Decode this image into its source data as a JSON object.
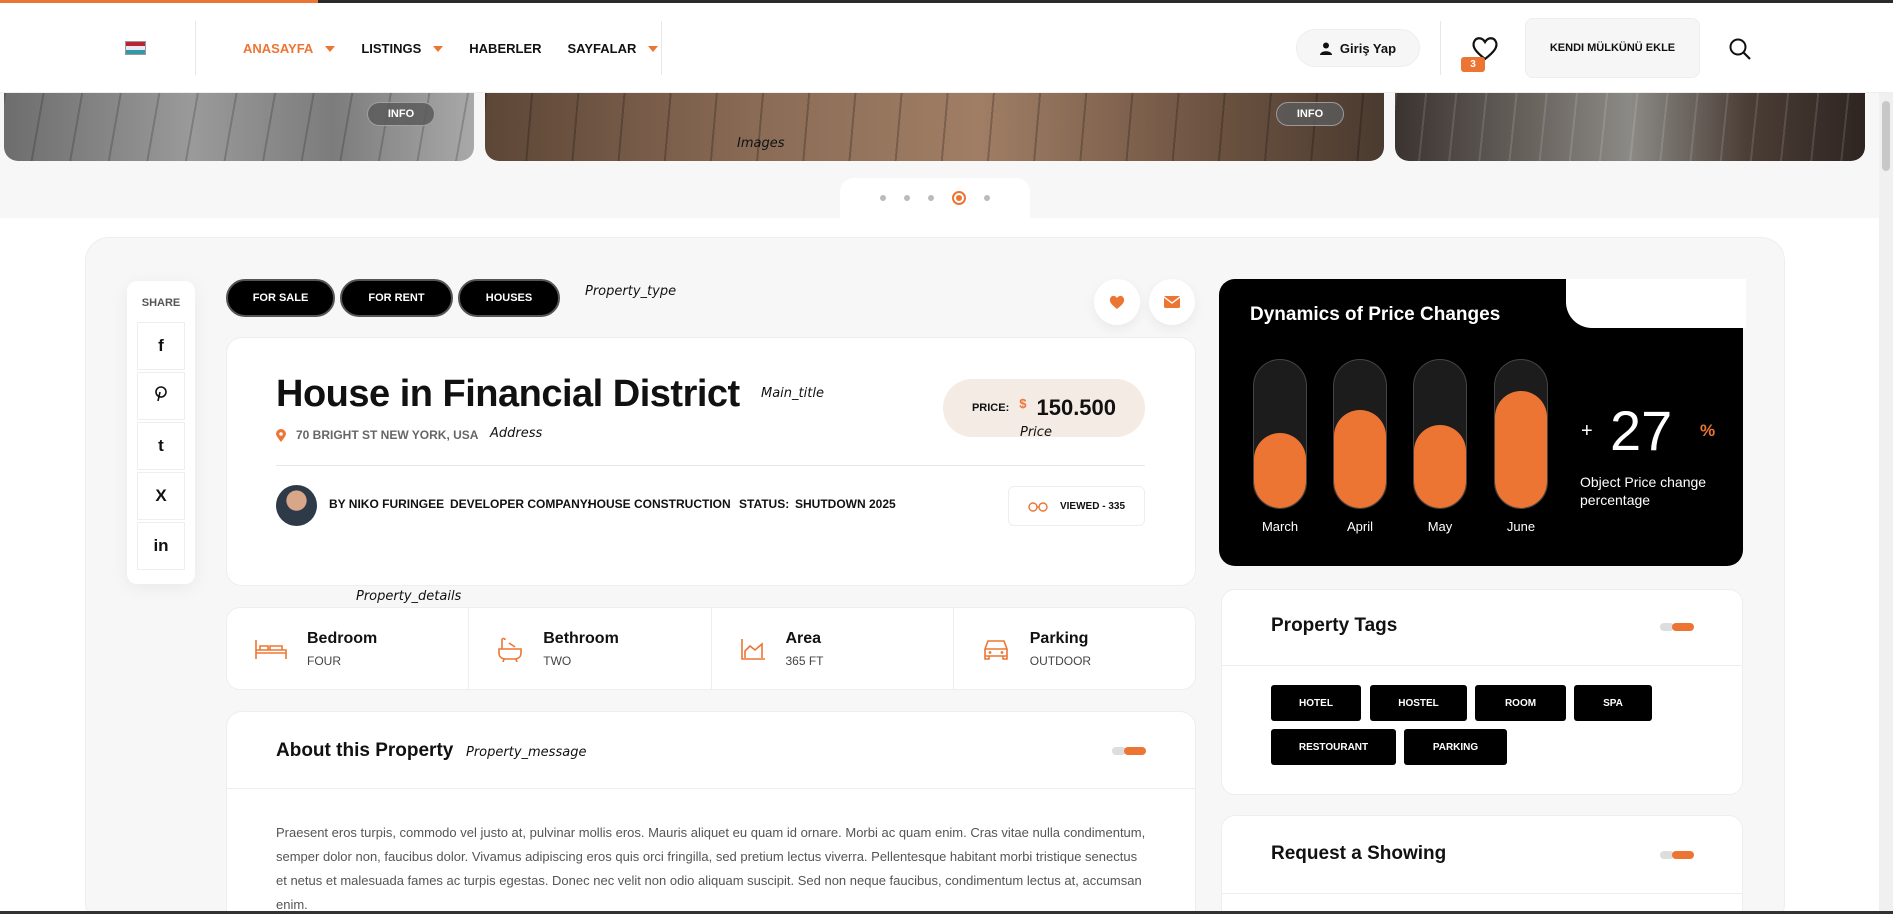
{
  "header": {
    "nav": [
      {
        "label": "ANASAYFA",
        "dropdown": true,
        "active": true
      },
      {
        "label": "LISTINGS",
        "dropdown": true,
        "active": false
      },
      {
        "label": "HABERLER",
        "dropdown": false,
        "active": false
      },
      {
        "label": "SAYFALAR",
        "dropdown": true,
        "active": false
      }
    ],
    "login_label": "Giriş Yap",
    "favorites_count": "3",
    "add_property_label": "KENDI MÜLKÜNÜ EKLE"
  },
  "gallery": {
    "info_label": "INFO",
    "annotation": "Images",
    "active_slide": 4,
    "slides": 5
  },
  "share": {
    "label": "SHARE",
    "networks": [
      "f",
      "P",
      "t",
      "X",
      "in"
    ]
  },
  "property": {
    "types": [
      "FOR SALE",
      "FOR RENT",
      "HOUSES"
    ],
    "type_annotation": "Property_type",
    "title": "House in Financial District",
    "title_annotation": "Main_title",
    "address": "70 BRIGHT ST NEW YORK, USA",
    "address_annotation": "Address",
    "price_label": "PRICE:",
    "currency": "$",
    "price": "150.500",
    "price_annotation": "Price",
    "author": "BY NIKO FURINGEE",
    "developer_label": "DEVELOPER COMPANY:",
    "developer": "HOUSE CONSTRUCTION",
    "status_label": "STATUS:",
    "status": "SHUTDOWN 2025",
    "viewed": "VIEWED - 335",
    "details_annotation": "Property_details"
  },
  "features": [
    {
      "title": "Bedroom",
      "value": "FOUR",
      "icon": "bed-icon"
    },
    {
      "title": "Bethroom",
      "value": "TWO",
      "icon": "bathtub-icon"
    },
    {
      "title": "Area",
      "value": "365 FT",
      "icon": "area-chart-icon"
    },
    {
      "title": "Parking",
      "value": "OUTDOOR",
      "icon": "car-icon"
    }
  ],
  "about": {
    "title": "About this Property",
    "annotation": "Property_message",
    "text": "Praesent eros turpis, commodo vel justo at, pulvinar mollis eros. Mauris aliquet eu quam id ornare. Morbi ac quam enim. Cras vitae nulla condimentum, semper dolor non, faucibus dolor. Vivamus adipiscing eros quis orci fringilla, sed pretium lectus viverra. Pellentesque habitant morbi tristique senectus et netus et malesuada fames ac turpis egestas. Donec nec velit non odio aliquam suscipit. Sed non neque faucibus, condimentum lectus at, accumsan enim."
  },
  "chart_data": {
    "type": "bar",
    "title": "Dynamics of Price Changes",
    "categories": [
      "March",
      "April",
      "May",
      "June"
    ],
    "values": [
      0.5,
      0.65,
      0.55,
      0.78
    ],
    "ylim": [
      0,
      1
    ],
    "summary_sign": "+",
    "summary_value": "27",
    "summary_unit": "%",
    "summary_caption": "Object Price change percentage",
    "colors": {
      "fill": "#ed7534",
      "track": "#1c1c1c",
      "background": "#000000"
    }
  },
  "tags": {
    "title": "Property Tags",
    "items": [
      "HOTEL",
      "HOSTEL",
      "ROOM",
      "SPA",
      "RESTOURANT",
      "PARKING"
    ]
  },
  "request": {
    "title": "Request a Showing"
  },
  "colors": {
    "accent": "#ed7534",
    "dark": "#000000"
  }
}
